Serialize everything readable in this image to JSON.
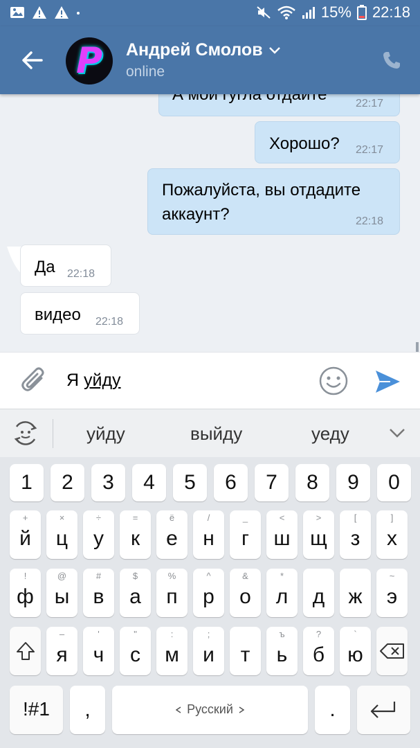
{
  "status_bar": {
    "battery": "15%",
    "time": "22:18"
  },
  "header": {
    "contact_name": "Андрей Смолов",
    "status": "online",
    "avatar_letter": "P",
    "accent": "#4a76a8"
  },
  "messages": [
    {
      "text": "А мои гугла отдайте",
      "time": "22:17",
      "direction": "out"
    },
    {
      "text": "Хорошо?",
      "time": "22:17",
      "direction": "out"
    },
    {
      "text_line1": "Пожалуйста, вы отдадите",
      "text_line2": "аккаунт?",
      "time": "22:18",
      "direction": "out"
    },
    {
      "text": "Да",
      "time": "22:18",
      "direction": "in"
    },
    {
      "text": "видео",
      "time": "22:18",
      "direction": "in"
    }
  ],
  "input": {
    "text_plain": "Я ",
    "text_underlined": "уйду"
  },
  "suggestions": [
    "уйду",
    "выйду",
    "уеду"
  ],
  "keyboard": {
    "numbers": [
      "1",
      "2",
      "3",
      "4",
      "5",
      "6",
      "7",
      "8",
      "9",
      "0"
    ],
    "row1": [
      "й",
      "ц",
      "у",
      "к",
      "е",
      "н",
      "г",
      "ш",
      "щ",
      "з",
      "х"
    ],
    "row1_hints": [
      "+",
      "×",
      "÷",
      "=",
      "ё",
      "/",
      "_",
      "<",
      ">",
      "[",
      "]"
    ],
    "row2": [
      "ф",
      "ы",
      "в",
      "а",
      "п",
      "р",
      "о",
      "л",
      "д",
      "ж",
      "э"
    ],
    "row2_hints": [
      "!",
      "@",
      "#",
      "$",
      "%",
      "^",
      "&",
      "*",
      "",
      "",
      "~"
    ],
    "row3": [
      "я",
      "ч",
      "с",
      "м",
      "и",
      "т",
      "ь",
      "б",
      "ю"
    ],
    "row3_hints": [
      "–",
      "'",
      "\"",
      ":",
      ";",
      "",
      "ъ",
      "?",
      "`"
    ],
    "symbols_label": "!#1",
    "comma": ",",
    "space_label": "Русский",
    "period": "."
  }
}
